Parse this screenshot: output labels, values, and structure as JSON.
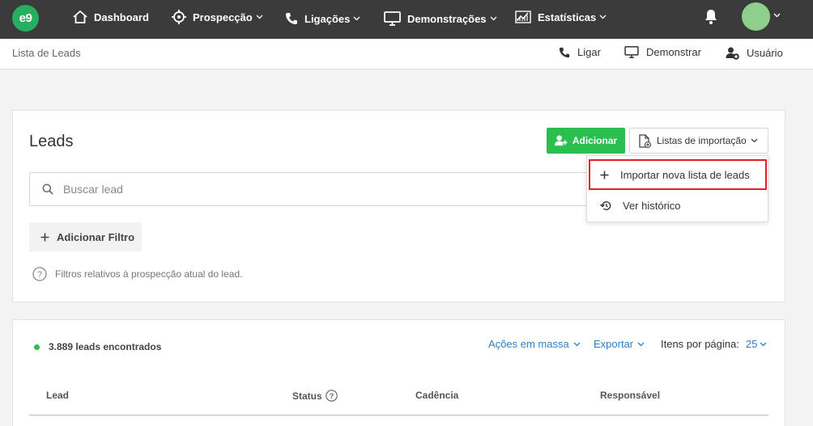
{
  "topnav": {
    "logo": "e9",
    "items": [
      {
        "label": "Dashboard",
        "icon": "home-icon"
      },
      {
        "label": "Prospecção",
        "icon": "target-icon"
      },
      {
        "label": "Ligações",
        "icon": "phone-icon"
      },
      {
        "label": "Demonstrações",
        "icon": "monitor-icon"
      },
      {
        "label": "Estatísticas",
        "icon": "chart-icon"
      }
    ],
    "notification_icon": "bell-icon"
  },
  "subbar": {
    "breadcrumb": "Lista de Leads",
    "actions": [
      {
        "label": "Ligar",
        "icon": "phone-icon"
      },
      {
        "label": "Demonstrar",
        "icon": "monitor-icon"
      },
      {
        "label": "Usuário",
        "icon": "user-add-icon"
      }
    ]
  },
  "leads_card": {
    "title": "Leads",
    "add_button": "Adicionar",
    "import_lists_button": "Listas de importação",
    "search_placeholder": "Buscar lead",
    "add_filter_button": "Adicionar Filtro",
    "filter_hint": "Filtros relativos à prospecção atual do lead."
  },
  "import_dropdown": {
    "items": [
      {
        "label": "Importar nova lista de leads",
        "icon": "plus-icon",
        "highlighted": true
      },
      {
        "label": "Ver histórico",
        "icon": "history-icon",
        "highlighted": false
      }
    ]
  },
  "results_card": {
    "count_label": "3.889 leads encontrados",
    "bulk_actions": "Ações em massa",
    "export": "Exportar",
    "per_page_label": "Itens por página:",
    "per_page_value": "25",
    "columns": [
      "Lead",
      "Status",
      "Cadência",
      "Responsável"
    ]
  },
  "colors": {
    "nav_bg": "#3b3b3b",
    "brand_green": "#27ae60",
    "add_button_green": "#2bbf4e",
    "link_blue": "#2f7fc6",
    "highlight_red": "#e01e26"
  }
}
